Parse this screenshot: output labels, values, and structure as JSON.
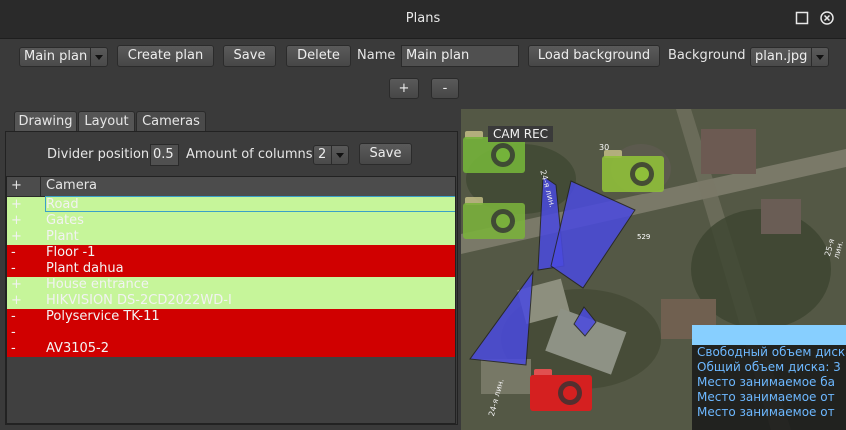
{
  "window": {
    "title": "Plans"
  },
  "toolbar": {
    "plan_select": "Main plan",
    "create_label": "Create plan",
    "save_label": "Save",
    "delete_label": "Delete",
    "name_label": "Name",
    "name_value": "Main plan",
    "load_bg_label": "Load background",
    "bg_label": "Background",
    "bg_select": "plan.jpg",
    "zoom_in": "+",
    "zoom_out": "-"
  },
  "tabs": [
    "Drawing",
    "Layout",
    "Cameras"
  ],
  "active_tab": "Cameras",
  "cameras_tab": {
    "divider_label": "Divider position",
    "divider_value": "0.5",
    "columns_label": "Amount of columns",
    "columns_value": "2",
    "save_label": "Save",
    "table_headers": [
      "+",
      "Camera"
    ],
    "rows": [
      {
        "mark": "+",
        "name": "Road",
        "status": "ok"
      },
      {
        "mark": "+",
        "name": "Gates",
        "status": "ok"
      },
      {
        "mark": "+",
        "name": "Plant",
        "status": "ok"
      },
      {
        "mark": "-",
        "name": "Floor -1",
        "status": "bad"
      },
      {
        "mark": "-",
        "name": "Plant dahua",
        "status": "bad"
      },
      {
        "mark": "+",
        "name": "House entrance",
        "status": "ok"
      },
      {
        "mark": "+",
        "name": "HIKVISION DS-2CD2022WD-I",
        "status": "ok"
      },
      {
        "mark": "-",
        "name": "Polyservice TK-11",
        "status": "bad"
      },
      {
        "mark": "-",
        "name": "",
        "status": "bad"
      },
      {
        "mark": "-",
        "name": "AV3105-2",
        "status": "bad"
      }
    ]
  },
  "map": {
    "cam_rec_label": "CAM REC",
    "map_labels": [
      "30",
      "24-я лин.",
      "529",
      "25-я лин.",
      "24-я лин."
    ],
    "info_lines": [
      "Свободный объем диска",
      "Общий объем диска: 3",
      "Место занимаемое ба",
      "Место занимаемое от",
      "Место занимаемое от"
    ]
  },
  "colors": {
    "ok": "#c6f59a",
    "bad": "#d00000",
    "accent": "#87cfff",
    "fov": "#4a4ae0"
  }
}
